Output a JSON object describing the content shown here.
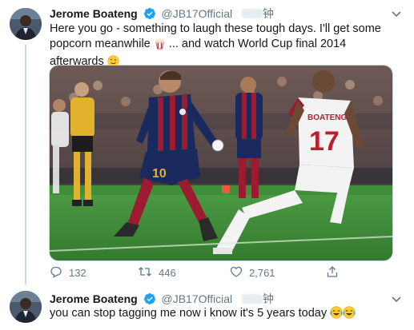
{
  "thread": [
    {
      "author": {
        "name": "Jerome Boateng",
        "handle": "@JB17Official",
        "verified": true,
        "blurred_suffix": "钟"
      },
      "text_before_emoji": "Here you go - something to laugh these tough days. I'll get some popcorn meanwhile",
      "emoji_1": "popcorn",
      "text_after_emoji": " ... and watch World Cup final 2014 afterwards",
      "emoji_2": "winking-face",
      "media": {
        "type": "photo",
        "jersey_name": "BOATENG",
        "jersey_number_right": "17",
        "jersey_number_left": "10",
        "sleeve_number": "10"
      },
      "stats": {
        "replies": "132",
        "retweets": "446",
        "likes": "2,761"
      }
    },
    {
      "author": {
        "name": "Jerome Boateng",
        "handle": "@JB17Official",
        "verified": true,
        "blurred_suffix": "钟"
      },
      "text": "you can stop tagging me now i know it's 5 years today",
      "emoji": [
        "face-with-tears-of-joy",
        "face-with-tears-of-joy"
      ]
    }
  ],
  "colors": {
    "verified": "#1da1f2",
    "secondary_text": "#657786",
    "grass": "#3f8f3a",
    "blaugrana_blue": "#1b2a5e",
    "blaugrana_red": "#9b1b30"
  }
}
